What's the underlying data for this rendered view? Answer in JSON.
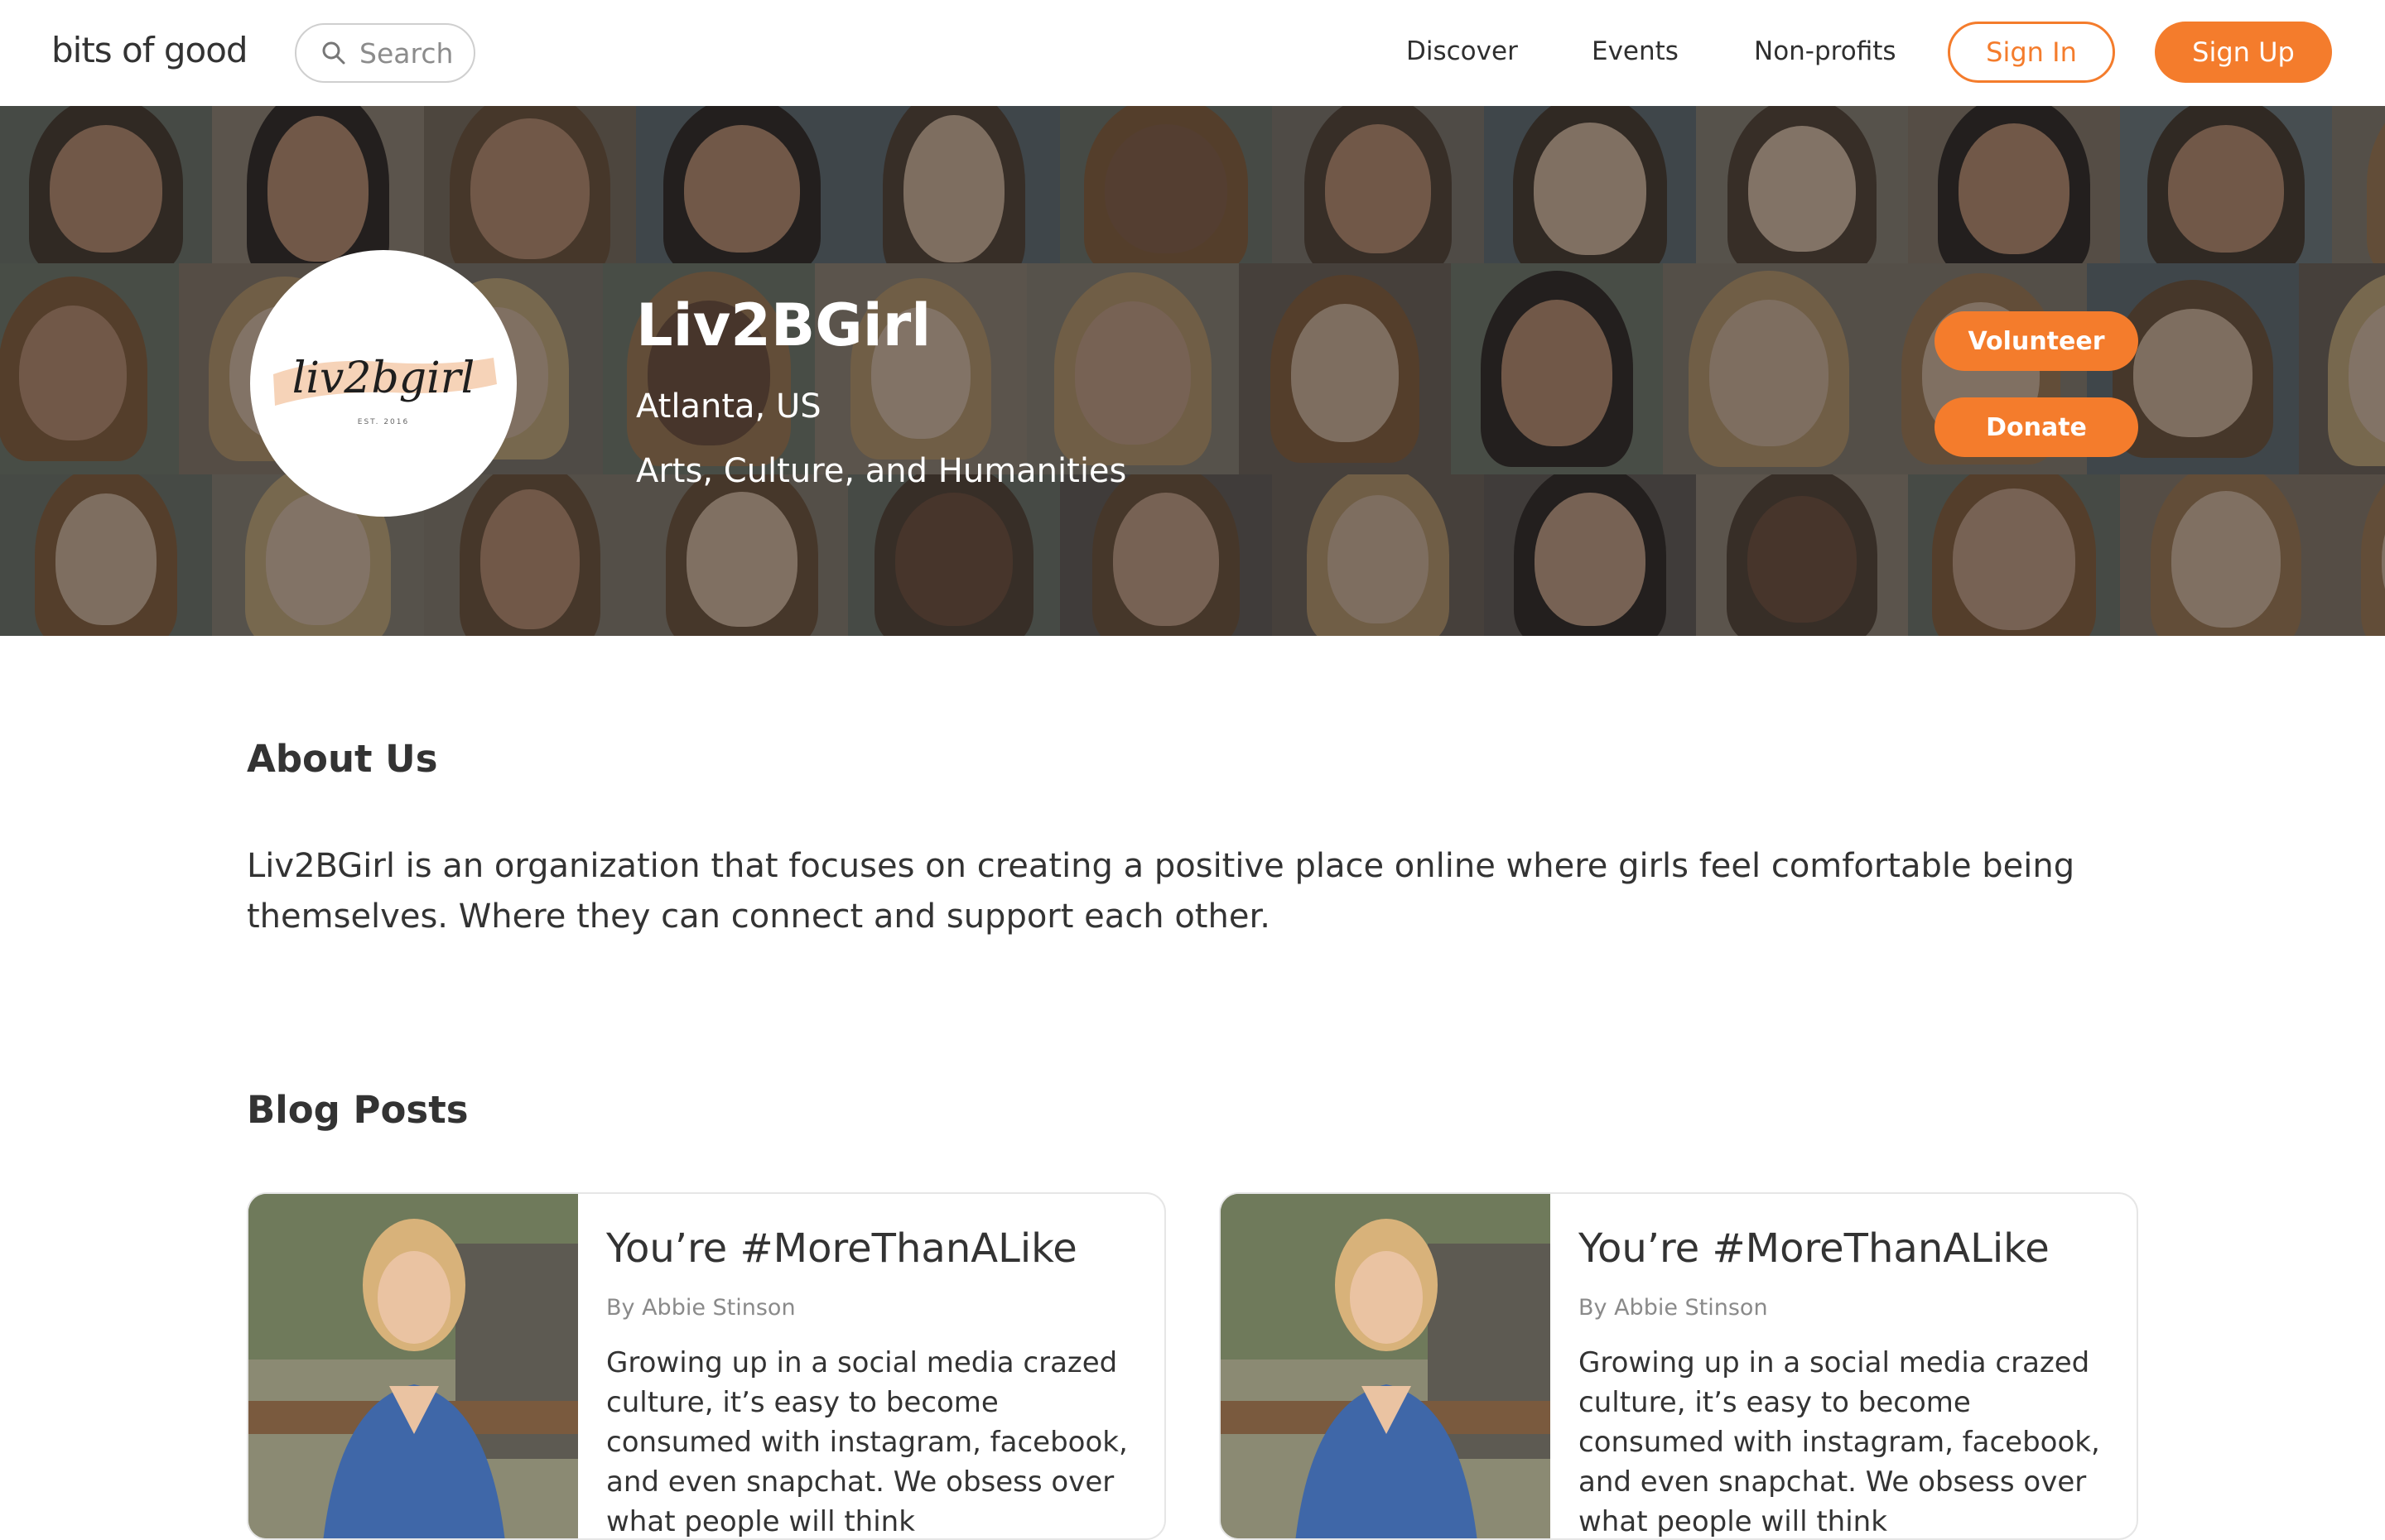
{
  "nav": {
    "logo": "bits of good",
    "search_placeholder": "Search",
    "links": [
      "Discover",
      "Events",
      "Non-profits"
    ],
    "sign_in": "Sign In",
    "sign_up": "Sign Up"
  },
  "hero": {
    "avatar_logo_text": "liv2bgirl",
    "avatar_logo_subtext": "EST. 2016",
    "name": "Liv2BGirl",
    "location": "Atlanta, US",
    "category": "Arts, Culture, and Humanities",
    "volunteer_label": "Volunteer",
    "donate_label": "Donate"
  },
  "about": {
    "heading": "About Us",
    "text": "Liv2BGirl is an organization that focuses on creating a positive place online where girls feel comfortable being themselves. Where they can connect and support each other."
  },
  "blog": {
    "heading": "Blog Posts",
    "posts": [
      {
        "title": "You’re #MoreThanALike",
        "author": "By Abbie Stinson",
        "excerpt": "Growing up in a social media crazed culture, it’s easy to become consumed with instagram, facebook, and even snapchat. We obsess over what people will think"
      },
      {
        "title": "You’re #MoreThanALike",
        "author": "By Abbie Stinson",
        "excerpt": "Growing up in a social media crazed culture, it’s easy to become consumed with instagram, facebook, and even snapchat. We obsess over what people will think"
      }
    ]
  },
  "colors": {
    "accent": "#f47c2c",
    "text": "#333333"
  }
}
